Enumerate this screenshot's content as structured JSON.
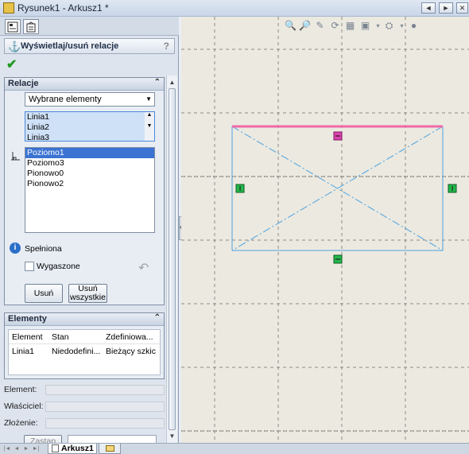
{
  "window": {
    "title": "Rysunek1 - Arkusz1 *",
    "buttons": [
      "◄",
      "►",
      "✕"
    ]
  },
  "property_manager": {
    "title": "Wyświetlaj/usuń relacje",
    "help": "?",
    "ok": "✔"
  },
  "relations": {
    "header": "Relacje",
    "filter": "Wybrane elementy",
    "entities": [
      "Linia1",
      "Linia2",
      "Linia3"
    ],
    "relations_list": [
      "Poziomo1",
      "Poziomo3",
      "Pionowo0",
      "Pionowo2"
    ],
    "selected_relation": "Poziomo1",
    "status": "Spełniona",
    "suppressed_label": "Wygaszone",
    "delete_button": "Usuń",
    "delete_all_button": "Usuń wszystkie"
  },
  "elements": {
    "header": "Elementy",
    "columns": [
      "Element",
      "Stan",
      "Zdefiniowa..."
    ],
    "rows": [
      [
        "Linia1",
        "Niedodefini...",
        "Bieżący szkic"
      ]
    ],
    "fields": {
      "element_label": "Element:",
      "owner_label": "Właściciel:",
      "assembly_label": "Złożenie:",
      "replace_button": "Zastąp"
    }
  },
  "sheet_tabs": {
    "active": "Arkusz1"
  },
  "colors": {
    "grid_line": "#8c8c84",
    "sketch_line": "#4fa3e0",
    "selected_line": "#f06aa8",
    "relation_horizontal": "#e040b0",
    "relation_vertical": "#22b84c",
    "canvas_bg": "#ebe9e0"
  }
}
